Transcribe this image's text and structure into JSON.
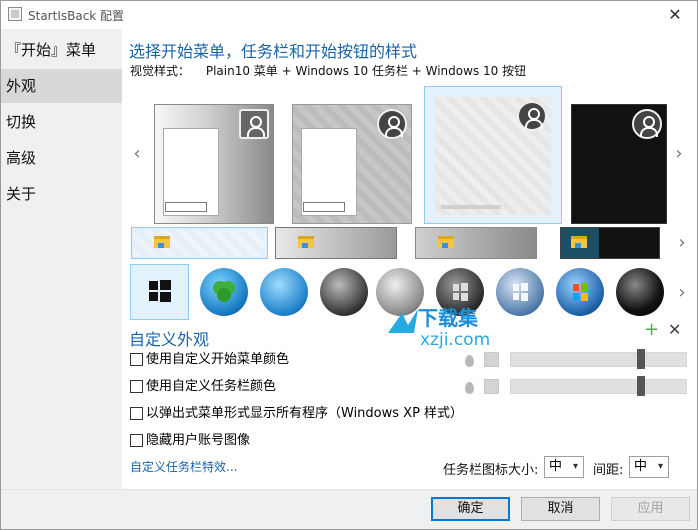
{
  "window": {
    "title": "StartIsBack 配置",
    "close_glyph": "✕"
  },
  "sidebar": {
    "items": [
      {
        "label": "『开始』菜单"
      },
      {
        "label": "外观"
      },
      {
        "label": "切换"
      },
      {
        "label": "高级"
      },
      {
        "label": "关于"
      }
    ],
    "selected": "外观"
  },
  "main": {
    "heading": "选择开始菜单，任务栏和开始按钮的样式",
    "visual_style_label": "视觉样式：",
    "visual_style_value": "Plain10 菜单 + Windows 10 任务栏 + Windows 10 按钮",
    "nav_left": "‹",
    "nav_right": "›",
    "selected_preview_index": 2,
    "orb_icons": [
      "windows-flat-icon",
      "clover-orb-icon",
      "bird-orb-icon",
      "windows-black-orb-icon",
      "windows-7-orb-icon",
      "windows-dark-orb-icon",
      "windows-blue-orb-icon",
      "windows-xp-orb-icon",
      "black-ball-orb-icon"
    ]
  },
  "customize": {
    "heading": "自定义外观",
    "add_glyph": "+",
    "remove_glyph": "✕",
    "options": [
      {
        "label": "使用自定义开始菜单颜色",
        "checked": false
      },
      {
        "label": "使用自定义任务栏颜色",
        "checked": false
      },
      {
        "label": "以弹出式菜单形式显示所有程序（Windows XP 样式）",
        "checked": false
      },
      {
        "label": "隐藏用户账号图像",
        "checked": false
      }
    ],
    "menu_color_opacity": 0.75,
    "taskbar_color_opacity": 0.75,
    "effects_link": "自定义任务栏特效...",
    "icon_size_label": "任务栏图标大小:",
    "icon_size_value": "中",
    "spacing_label": "间距:",
    "spacing_value": "中",
    "caret": "▾"
  },
  "watermark": {
    "brand": "下载集",
    "domain": "xzji.com"
  },
  "footer": {
    "ok": "确定",
    "cancel": "取消",
    "apply": "应用"
  },
  "colors": {
    "accent": "#1b63a8",
    "selected_bg": "#e2f1fb",
    "selected_border": "#8fcdf0",
    "sidebar_bg": "#f0f0f0",
    "plus": "#4caf50"
  }
}
